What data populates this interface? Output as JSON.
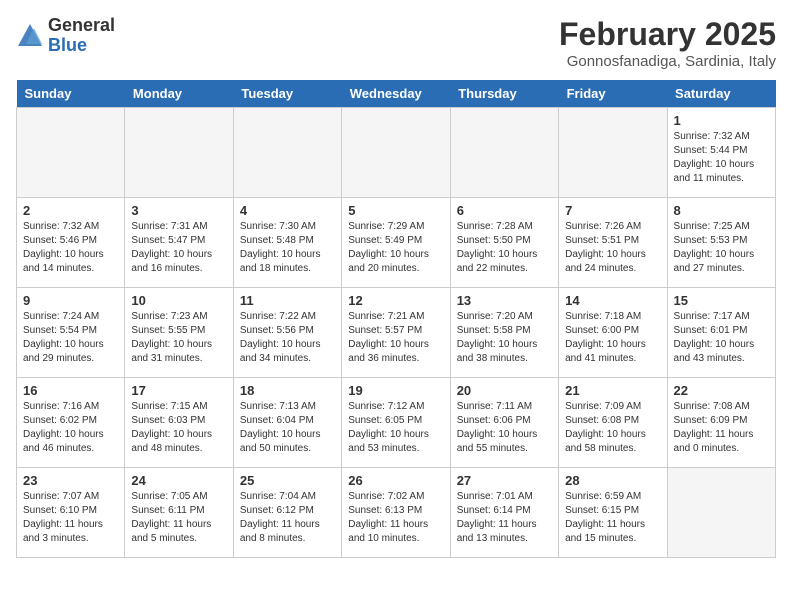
{
  "logo": {
    "general": "General",
    "blue": "Blue"
  },
  "title": "February 2025",
  "subtitle": "Gonnosfanadiga, Sardinia, Italy",
  "weekdays": [
    "Sunday",
    "Monday",
    "Tuesday",
    "Wednesday",
    "Thursday",
    "Friday",
    "Saturday"
  ],
  "weeks": [
    [
      {
        "num": "",
        "info": ""
      },
      {
        "num": "",
        "info": ""
      },
      {
        "num": "",
        "info": ""
      },
      {
        "num": "",
        "info": ""
      },
      {
        "num": "",
        "info": ""
      },
      {
        "num": "",
        "info": ""
      },
      {
        "num": "1",
        "info": "Sunrise: 7:32 AM\nSunset: 5:44 PM\nDaylight: 10 hours and 11 minutes."
      }
    ],
    [
      {
        "num": "2",
        "info": "Sunrise: 7:32 AM\nSunset: 5:46 PM\nDaylight: 10 hours and 14 minutes."
      },
      {
        "num": "3",
        "info": "Sunrise: 7:31 AM\nSunset: 5:47 PM\nDaylight: 10 hours and 16 minutes."
      },
      {
        "num": "4",
        "info": "Sunrise: 7:30 AM\nSunset: 5:48 PM\nDaylight: 10 hours and 18 minutes."
      },
      {
        "num": "5",
        "info": "Sunrise: 7:29 AM\nSunset: 5:49 PM\nDaylight: 10 hours and 20 minutes."
      },
      {
        "num": "6",
        "info": "Sunrise: 7:28 AM\nSunset: 5:50 PM\nDaylight: 10 hours and 22 minutes."
      },
      {
        "num": "7",
        "info": "Sunrise: 7:26 AM\nSunset: 5:51 PM\nDaylight: 10 hours and 24 minutes."
      },
      {
        "num": "8",
        "info": "Sunrise: 7:25 AM\nSunset: 5:53 PM\nDaylight: 10 hours and 27 minutes."
      }
    ],
    [
      {
        "num": "9",
        "info": "Sunrise: 7:24 AM\nSunset: 5:54 PM\nDaylight: 10 hours and 29 minutes."
      },
      {
        "num": "10",
        "info": "Sunrise: 7:23 AM\nSunset: 5:55 PM\nDaylight: 10 hours and 31 minutes."
      },
      {
        "num": "11",
        "info": "Sunrise: 7:22 AM\nSunset: 5:56 PM\nDaylight: 10 hours and 34 minutes."
      },
      {
        "num": "12",
        "info": "Sunrise: 7:21 AM\nSunset: 5:57 PM\nDaylight: 10 hours and 36 minutes."
      },
      {
        "num": "13",
        "info": "Sunrise: 7:20 AM\nSunset: 5:58 PM\nDaylight: 10 hours and 38 minutes."
      },
      {
        "num": "14",
        "info": "Sunrise: 7:18 AM\nSunset: 6:00 PM\nDaylight: 10 hours and 41 minutes."
      },
      {
        "num": "15",
        "info": "Sunrise: 7:17 AM\nSunset: 6:01 PM\nDaylight: 10 hours and 43 minutes."
      }
    ],
    [
      {
        "num": "16",
        "info": "Sunrise: 7:16 AM\nSunset: 6:02 PM\nDaylight: 10 hours and 46 minutes."
      },
      {
        "num": "17",
        "info": "Sunrise: 7:15 AM\nSunset: 6:03 PM\nDaylight: 10 hours and 48 minutes."
      },
      {
        "num": "18",
        "info": "Sunrise: 7:13 AM\nSunset: 6:04 PM\nDaylight: 10 hours and 50 minutes."
      },
      {
        "num": "19",
        "info": "Sunrise: 7:12 AM\nSunset: 6:05 PM\nDaylight: 10 hours and 53 minutes."
      },
      {
        "num": "20",
        "info": "Sunrise: 7:11 AM\nSunset: 6:06 PM\nDaylight: 10 hours and 55 minutes."
      },
      {
        "num": "21",
        "info": "Sunrise: 7:09 AM\nSunset: 6:08 PM\nDaylight: 10 hours and 58 minutes."
      },
      {
        "num": "22",
        "info": "Sunrise: 7:08 AM\nSunset: 6:09 PM\nDaylight: 11 hours and 0 minutes."
      }
    ],
    [
      {
        "num": "23",
        "info": "Sunrise: 7:07 AM\nSunset: 6:10 PM\nDaylight: 11 hours and 3 minutes."
      },
      {
        "num": "24",
        "info": "Sunrise: 7:05 AM\nSunset: 6:11 PM\nDaylight: 11 hours and 5 minutes."
      },
      {
        "num": "25",
        "info": "Sunrise: 7:04 AM\nSunset: 6:12 PM\nDaylight: 11 hours and 8 minutes."
      },
      {
        "num": "26",
        "info": "Sunrise: 7:02 AM\nSunset: 6:13 PM\nDaylight: 11 hours and 10 minutes."
      },
      {
        "num": "27",
        "info": "Sunrise: 7:01 AM\nSunset: 6:14 PM\nDaylight: 11 hours and 13 minutes."
      },
      {
        "num": "28",
        "info": "Sunrise: 6:59 AM\nSunset: 6:15 PM\nDaylight: 11 hours and 15 minutes."
      },
      {
        "num": "",
        "info": ""
      }
    ]
  ]
}
